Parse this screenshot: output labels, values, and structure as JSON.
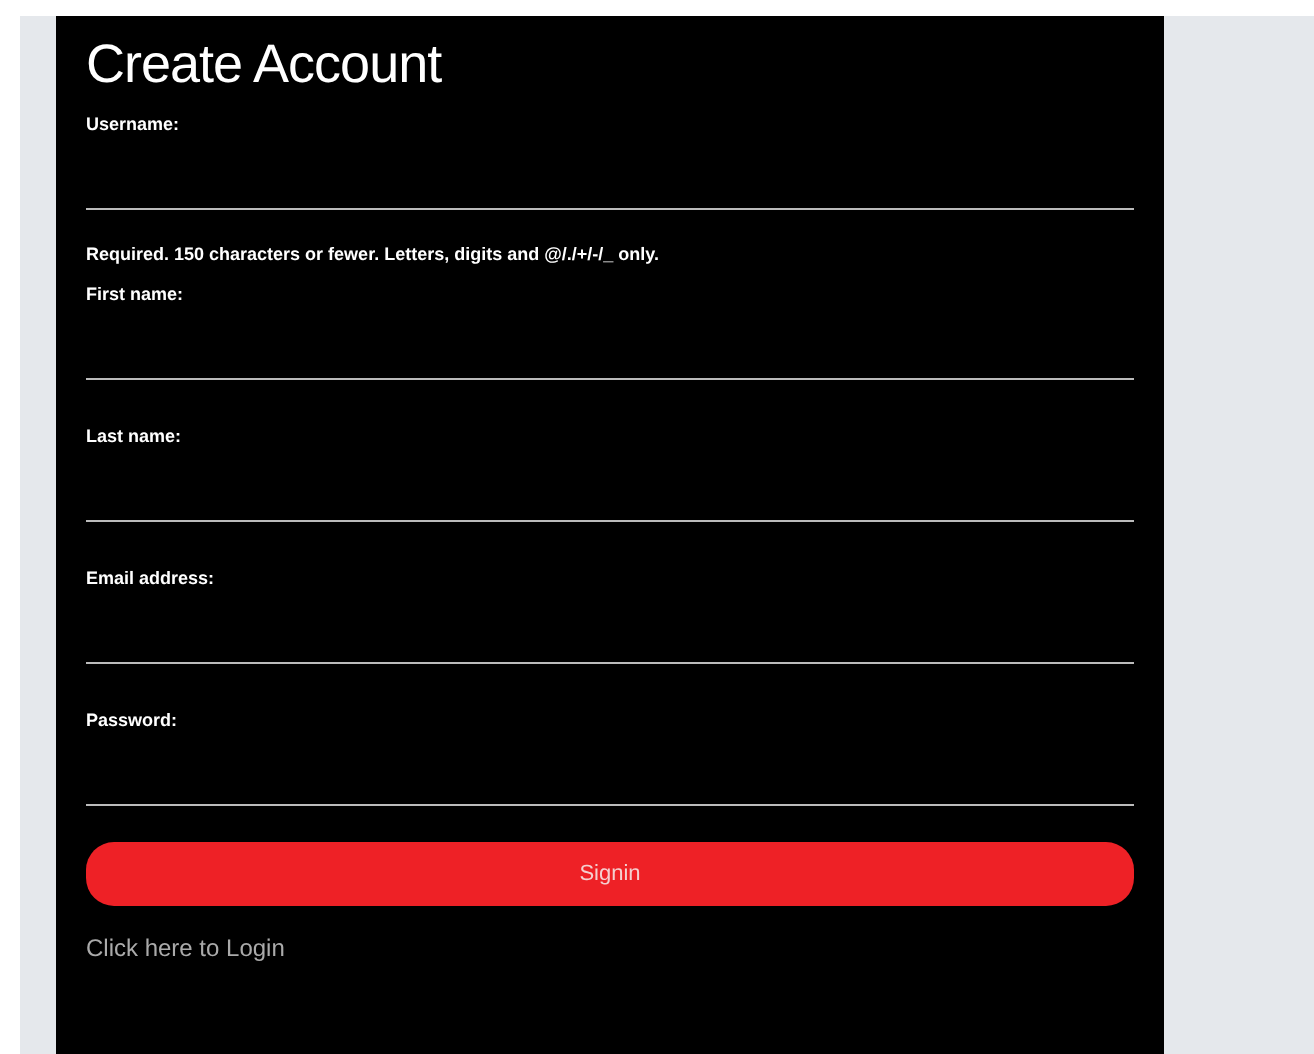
{
  "title": "Create Account",
  "fields": [
    {
      "label": "Username:",
      "help": "Required. 150 characters or fewer. Letters, digits and @/./+/-/_ only."
    },
    {
      "label": "First name:"
    },
    {
      "label": "Last name:"
    },
    {
      "label": "Email address:"
    },
    {
      "label": "Password:"
    }
  ],
  "submit": "Signin",
  "login_link": "Click here to Login"
}
